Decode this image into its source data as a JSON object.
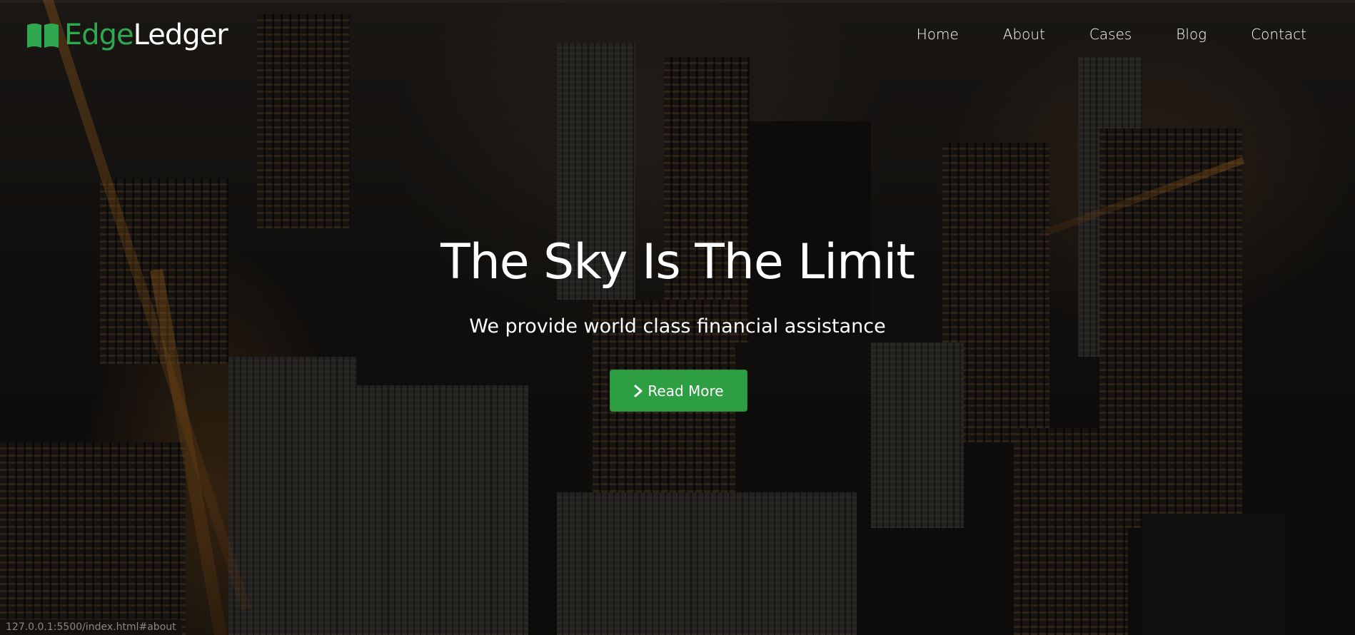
{
  "logo": {
    "part1": "Edge",
    "part2": "Ledger",
    "icon": "open-book-icon",
    "accent_color": "#2fa84f"
  },
  "nav": {
    "items": [
      {
        "label": "Home"
      },
      {
        "label": "About"
      },
      {
        "label": "Cases"
      },
      {
        "label": "Blog"
      },
      {
        "label": "Contact"
      }
    ]
  },
  "hero": {
    "title": "The Sky Is The Limit",
    "subtitle": "We provide world class financial assistance",
    "cta_label": "Read More",
    "cta_icon": "chevron-right-icon",
    "cta_color": "#2e9e43",
    "background": "night city skyline aerial photo"
  },
  "status_bar": {
    "url": "127.0.0.1:5500/index.html#about"
  }
}
